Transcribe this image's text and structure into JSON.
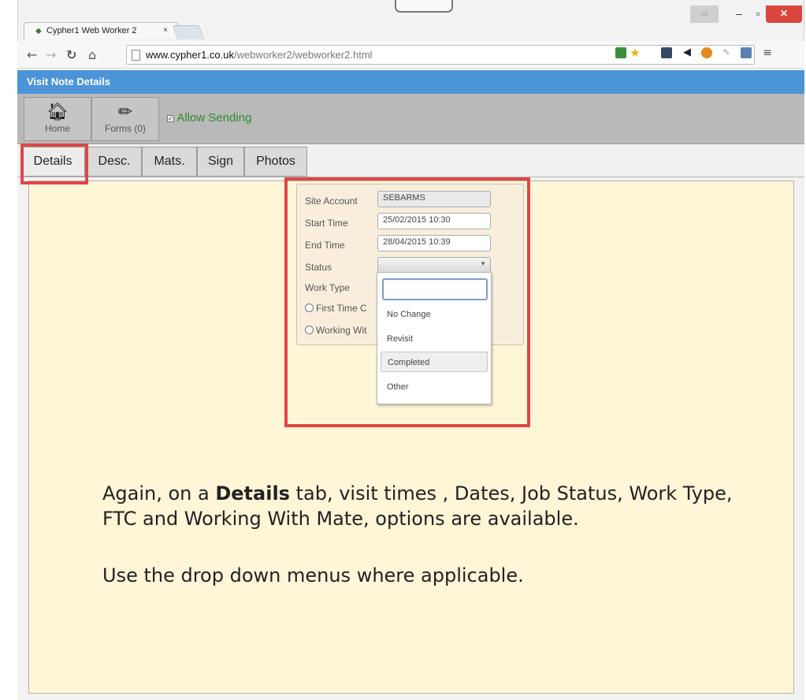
{
  "browser": {
    "tab_title": "Cypher1 Web Worker 2",
    "tab_close": "×",
    "url_scheme_host": "www.cypher1.co.uk",
    "url_path": "/webworker2/webworker2.html"
  },
  "app": {
    "title": "Visit Note Details",
    "toolbar": {
      "home_label": "Home",
      "forms_label": "Forms (0)",
      "allow_sending_label": "Allow Sending"
    },
    "tabs": [
      {
        "label": "Details"
      },
      {
        "label": "Desc."
      },
      {
        "label": "Mats."
      },
      {
        "label": "Sign"
      },
      {
        "label": "Photos"
      }
    ],
    "form": {
      "site_account_label": "Site Account",
      "site_account_value": "SEBARMS",
      "start_time_label": "Start Time",
      "start_time_value": "25/02/2015 10:30",
      "end_time_label": "End Time",
      "end_time_value": "28/04/2015 10:39",
      "status_label": "Status",
      "status_value": "",
      "work_type_label": "Work Type",
      "first_time_label": "First Time C",
      "working_with_label": "Working Wit"
    },
    "status_dropdown": {
      "options": [
        "No Change",
        "Revisit",
        "Completed",
        "Other"
      ],
      "highlighted": "Completed"
    }
  },
  "caption": {
    "line1_pre": "Again, on a ",
    "line1_bold": "Details",
    "line1_post": " tab, visit times , Dates, Job Status, Work Type, FTC and Working With Mate, options are available.",
    "line2": "Use the drop down menus where applicable."
  },
  "colors": {
    "header_blue": "#4b94d8",
    "panel_bg": "#fff5d7",
    "highlight_red": "#e04646",
    "allow_green": "#2e8b2e"
  }
}
